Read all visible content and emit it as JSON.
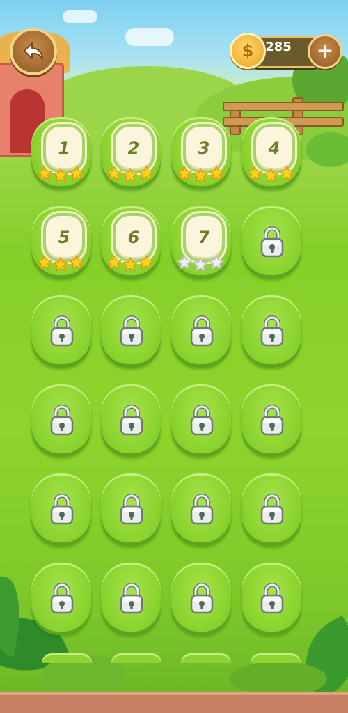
{
  "header": {
    "back_icon": "back-arrow-icon",
    "coin_icon": "coin-icon",
    "coin_symbol": "$",
    "coins": "285",
    "plus_symbol": "+"
  },
  "levels": [
    {
      "label": "1",
      "stars": 3,
      "locked": false
    },
    {
      "label": "2",
      "stars": 3,
      "locked": false
    },
    {
      "label": "3",
      "stars": 3,
      "locked": false
    },
    {
      "label": "4",
      "stars": 3,
      "locked": false
    },
    {
      "label": "5",
      "stars": 3,
      "locked": false
    },
    {
      "label": "6",
      "stars": 3,
      "locked": false
    },
    {
      "label": "7",
      "stars": 0,
      "locked": false
    },
    {
      "label": "",
      "stars": 0,
      "locked": true
    },
    {
      "label": "",
      "stars": 0,
      "locked": true
    },
    {
      "label": "",
      "stars": 0,
      "locked": true
    },
    {
      "label": "",
      "stars": 0,
      "locked": true
    },
    {
      "label": "",
      "stars": 0,
      "locked": true
    },
    {
      "label": "",
      "stars": 0,
      "locked": true
    },
    {
      "label": "",
      "stars": 0,
      "locked": true
    },
    {
      "label": "",
      "stars": 0,
      "locked": true
    },
    {
      "label": "",
      "stars": 0,
      "locked": true
    },
    {
      "label": "",
      "stars": 0,
      "locked": true
    },
    {
      "label": "",
      "stars": 0,
      "locked": true
    },
    {
      "label": "",
      "stars": 0,
      "locked": true
    },
    {
      "label": "",
      "stars": 0,
      "locked": true
    },
    {
      "label": "",
      "stars": 0,
      "locked": true
    },
    {
      "label": "",
      "stars": 0,
      "locked": true
    },
    {
      "label": "",
      "stars": 0,
      "locked": true
    },
    {
      "label": "",
      "stars": 0,
      "locked": true
    }
  ],
  "colors": {
    "star_earned": "#ffd21f",
    "star_empty": "#eef0f0",
    "tile_green": "#8cd42f",
    "coin_gold": "#e9a21e"
  }
}
